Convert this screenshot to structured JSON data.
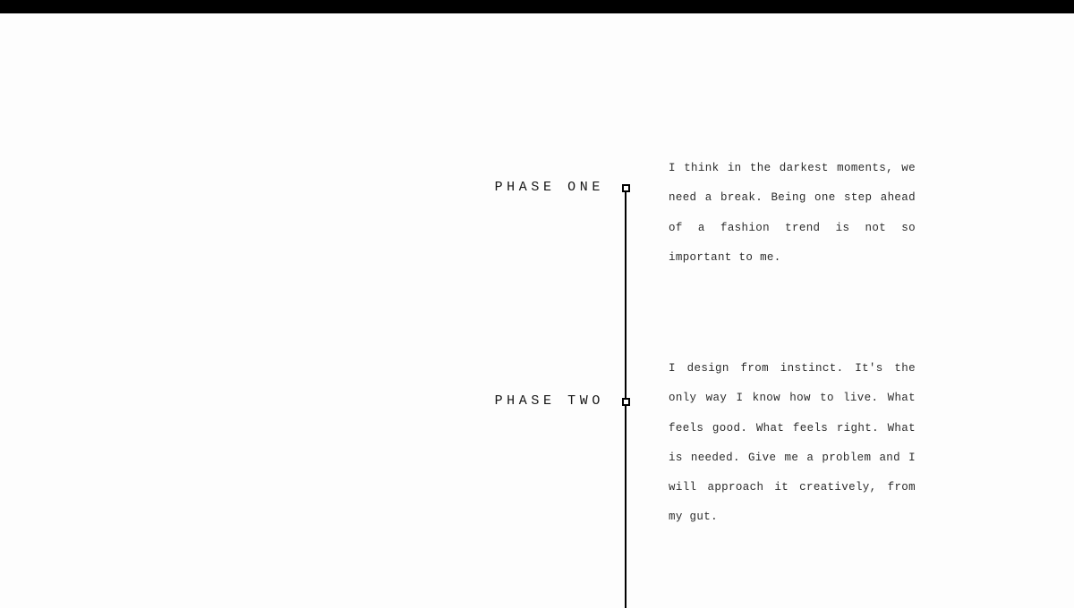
{
  "page": {
    "background_color": "#fdfdfd",
    "accent_color": "#000000",
    "text_color": "#2b2b2b",
    "top_bar_color": "#000000"
  },
  "timeline": {
    "marker_shape": "hollow-square",
    "phases": [
      {
        "label": "PHASE ONE",
        "body": "I think in the darkest moments, we need a break. Being one step ahead of a fashion trend is not so important to me."
      },
      {
        "label": "PHASE TWO",
        "body": "I design from instinct. It's the only way I know how to live. What feels good. What feels right. What is needed. Give me a problem and I will approach it creatively, from my gut."
      }
    ]
  }
}
